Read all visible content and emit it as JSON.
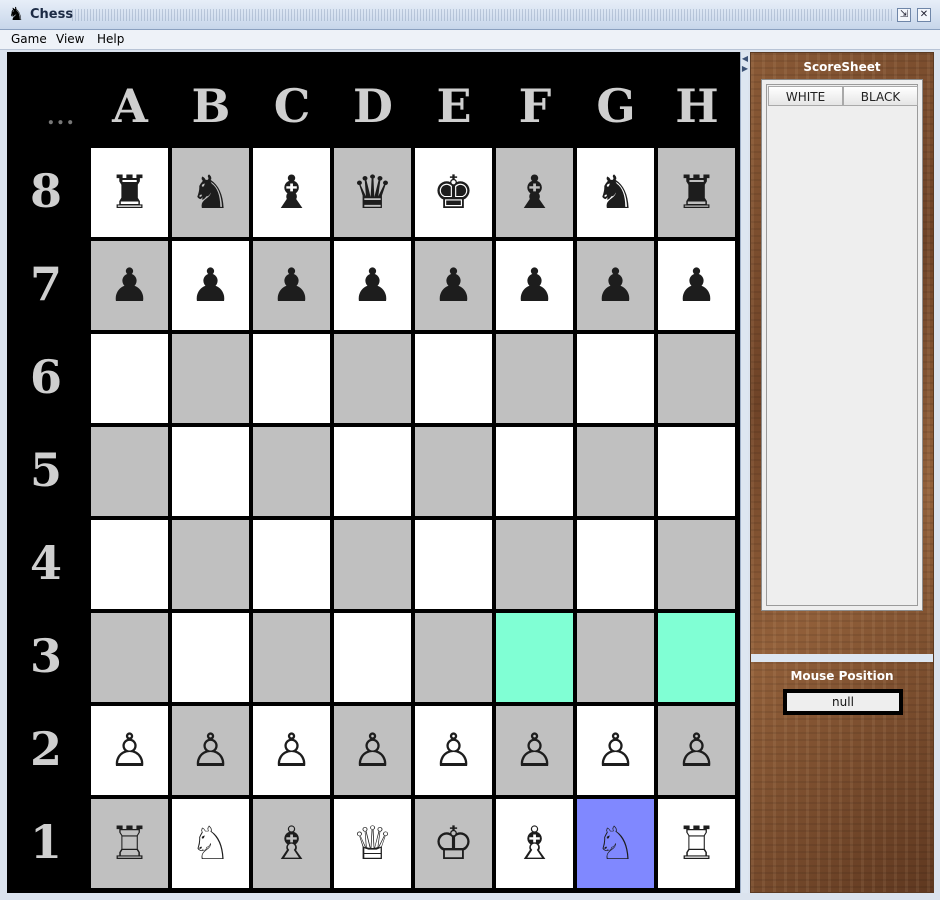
{
  "window": {
    "title": "Chess"
  },
  "menu": [
    "Game",
    "View",
    "Help"
  ],
  "board": {
    "ellipsis": "...",
    "files": [
      "A",
      "B",
      "C",
      "D",
      "E",
      "F",
      "G",
      "H"
    ],
    "ranks": [
      "8",
      "7",
      "6",
      "5",
      "4",
      "3",
      "2",
      "1"
    ],
    "squares": [
      [
        {
          "piece": "♜",
          "color": "black"
        },
        {
          "piece": "♞",
          "color": "black"
        },
        {
          "piece": "♝",
          "color": "black"
        },
        {
          "piece": "♛",
          "color": "black"
        },
        {
          "piece": "♚",
          "color": "black"
        },
        {
          "piece": "♝",
          "color": "black"
        },
        {
          "piece": "♞",
          "color": "black"
        },
        {
          "piece": "♜",
          "color": "black"
        }
      ],
      [
        {
          "piece": "♟",
          "color": "black"
        },
        {
          "piece": "♟",
          "color": "black"
        },
        {
          "piece": "♟",
          "color": "black"
        },
        {
          "piece": "♟",
          "color": "black"
        },
        {
          "piece": "♟",
          "color": "black"
        },
        {
          "piece": "♟",
          "color": "black"
        },
        {
          "piece": "♟",
          "color": "black"
        },
        {
          "piece": "♟",
          "color": "black"
        }
      ],
      [
        {},
        {},
        {},
        {},
        {},
        {},
        {},
        {}
      ],
      [
        {},
        {},
        {},
        {},
        {},
        {},
        {},
        {}
      ],
      [
        {},
        {},
        {},
        {},
        {},
        {},
        {},
        {}
      ],
      [
        {},
        {},
        {},
        {},
        {},
        {
          "highlight": "hint"
        },
        {},
        {
          "highlight": "hint"
        }
      ],
      [
        {
          "piece": "♙",
          "color": "white"
        },
        {
          "piece": "♙",
          "color": "white"
        },
        {
          "piece": "♙",
          "color": "white"
        },
        {
          "piece": "♙",
          "color": "white"
        },
        {
          "piece": "♙",
          "color": "white"
        },
        {
          "piece": "♙",
          "color": "white"
        },
        {
          "piece": "♙",
          "color": "white"
        },
        {
          "piece": "♙",
          "color": "white"
        }
      ],
      [
        {
          "piece": "♖",
          "color": "white"
        },
        {
          "piece": "♘",
          "color": "white"
        },
        {
          "piece": "♗",
          "color": "white"
        },
        {
          "piece": "♕",
          "color": "white"
        },
        {
          "piece": "♔",
          "color": "white"
        },
        {
          "piece": "♗",
          "color": "white"
        },
        {
          "piece": "♘",
          "color": "white",
          "highlight": "selected"
        },
        {
          "piece": "♖",
          "color": "white"
        }
      ]
    ],
    "colors": {
      "light": "#ffffff",
      "dark": "#c0c0c0",
      "hint": "#80ffd4",
      "selected": "#8088ff"
    }
  },
  "scoresheet": {
    "title": "ScoreSheet",
    "columns": [
      "WHITE",
      "BLACK"
    ]
  },
  "mouse_position": {
    "title": "Mouse Position",
    "value": "null"
  }
}
